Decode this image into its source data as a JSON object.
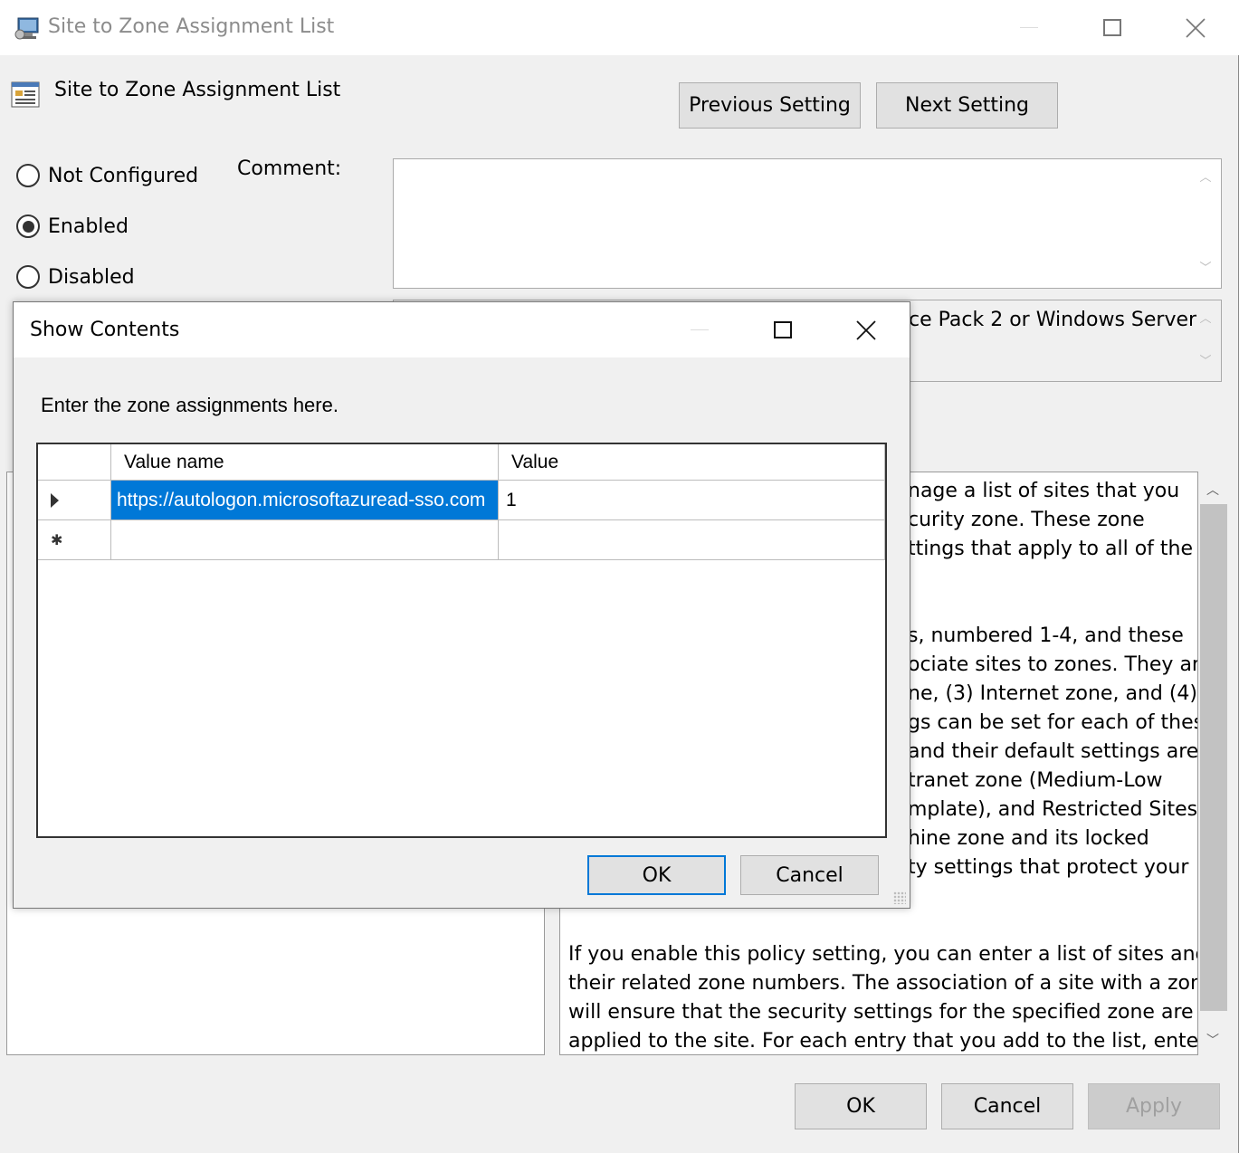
{
  "main": {
    "title": "Site to Zone Assignment List",
    "header_title": "Site to Zone Assignment List",
    "previous_label": "Previous Setting",
    "next_label": "Next Setting",
    "options": [
      "Not Configured",
      "Enabled",
      "Disabled"
    ],
    "selected_option": "Enabled",
    "comment_label": "Comment:",
    "comment_value": "",
    "supported_on_visible": "ce Pack 2 or Windows Server",
    "help_lines_top": [
      "nage a list of sites that you",
      "curity zone. These zone",
      "ttings that apply to all of the",
      "",
      "",
      "s, numbered 1-4, and these",
      "ociate sites to zones. They are:",
      "ne, (3) Internet zone, and (4)",
      "gs can be set for each of these",
      " and their default settings are:",
      "tranet zone (Medium-Low",
      "mplate), and Restricted Sites",
      "hine zone and its locked",
      "ty settings that protect your"
    ],
    "help_lines_bottom": [
      "If you enable this policy setting, you can enter a list of sites and",
      "their related zone numbers. The association of a site with a zone",
      "will ensure that the security settings for the specified zone are",
      "applied to the site.  For each entry that you add to the list, enter"
    ],
    "ok_label": "OK",
    "cancel_label": "Cancel",
    "apply_label": "Apply"
  },
  "dialog": {
    "title": "Show Contents",
    "instruction": "Enter the zone assignments here.",
    "columns": [
      "Value name",
      "Value"
    ],
    "rows": [
      {
        "name": "https://autologon.microsoftazuread-sso.com",
        "value": "1"
      }
    ],
    "ok_label": "OK",
    "cancel_label": "Cancel"
  },
  "colors": {
    "selection": "#0078d7",
    "window_bg": "#f0f0f0"
  }
}
